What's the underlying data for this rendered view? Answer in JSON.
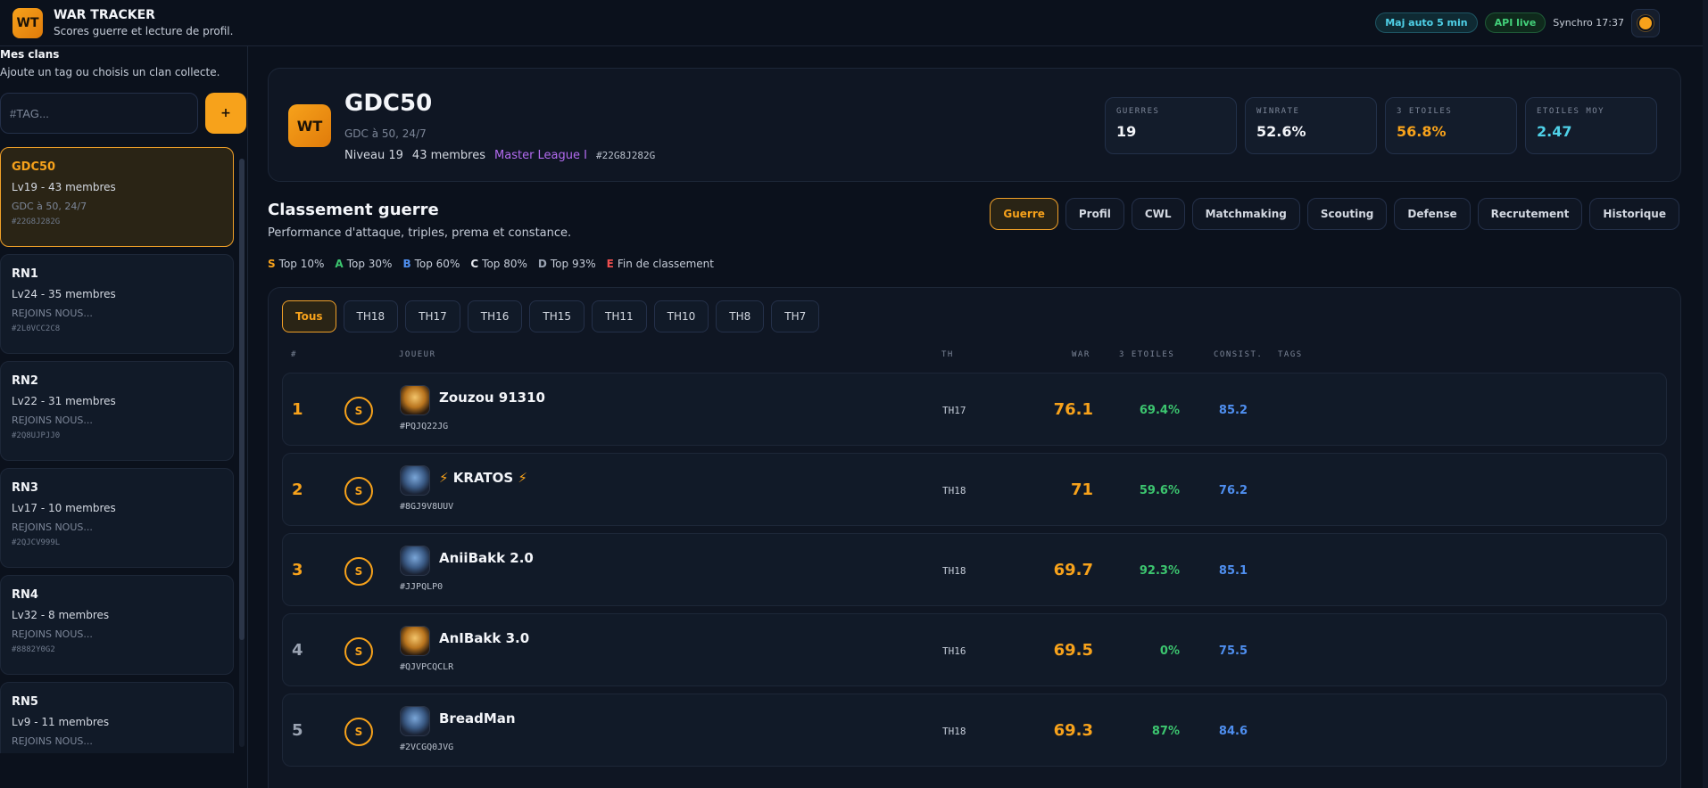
{
  "app": {
    "logo": "WT",
    "title": "WAR TRACKER",
    "subtitle": "Scores guerre et lecture de profil.",
    "pill_auto": "Maj auto 5 min",
    "pill_api": "API live",
    "sync": "Synchro 17:37",
    "theme_icon": "sun-icon"
  },
  "sidebar": {
    "title": "Mes clans",
    "subtitle": "Ajoute un tag ou choisis un clan collecte.",
    "input_placeholder": "#TAG...",
    "add_label": "+",
    "clans": [
      {
        "name": "GDC50",
        "meta": "Lv19 - 43 membres",
        "desc": "GDC à 50, 24/7",
        "tag": "#22G8J282G",
        "active": true
      },
      {
        "name": "RN1",
        "meta": "Lv24 - 35 membres",
        "desc": "REJOINS NOUS...",
        "tag": "#2L0VCC2C8",
        "active": false
      },
      {
        "name": "RN2",
        "meta": "Lv22 - 31 membres",
        "desc": "REJOINS NOUS...",
        "tag": "#2Q8UJPJJ0",
        "active": false
      },
      {
        "name": "RN3",
        "meta": "Lv17 - 10 membres",
        "desc": "REJOINS NOUS...",
        "tag": "#2QJCV999L",
        "active": false
      },
      {
        "name": "RN4",
        "meta": "Lv32 - 8 membres",
        "desc": "REJOINS NOUS...",
        "tag": "#8882Y0G2",
        "active": false
      },
      {
        "name": "RN5",
        "meta": "Lv9 - 11 membres",
        "desc": "REJOINS NOUS...",
        "tag": "",
        "active": false
      }
    ]
  },
  "clan": {
    "logo": "WT",
    "name": "GDC50",
    "desc": "GDC à 50, 24/7",
    "level": "Niveau 19",
    "members": "43 membres",
    "league": "Master League I",
    "tag": "#22G8J282G",
    "stats": [
      {
        "label": "Guerres",
        "value": "19",
        "color": "#f3f5f9"
      },
      {
        "label": "Winrate",
        "value": "52.6%",
        "color": "#f3f5f9"
      },
      {
        "label": "3 Etoiles",
        "value": "56.8%",
        "color": "#f7a21b"
      },
      {
        "label": "Etoiles moy",
        "value": "2.47",
        "color": "#4fd1e8"
      }
    ]
  },
  "section": {
    "title": "Classement guerre",
    "subtitle": "Performance d'attaque, triples, prema et constance.",
    "legend": [
      {
        "key": "S",
        "label": "Top 10%",
        "color": "#f7a21b"
      },
      {
        "key": "A",
        "label": "Top 30%",
        "color": "#3cc56f"
      },
      {
        "key": "B",
        "label": "Top 60%",
        "color": "#4f8ff0"
      },
      {
        "key": "C",
        "label": "Top 80%",
        "color": "#e6e9ef"
      },
      {
        "key": "D",
        "label": "Top 93%",
        "color": "#9aa3b2"
      },
      {
        "key": "E",
        "label": "Fin de classement",
        "color": "#ef4f4f"
      }
    ],
    "tabs": [
      "Guerre",
      "Profil",
      "CWL",
      "Matchmaking",
      "Scouting",
      "Defense",
      "Recrutement",
      "Historique"
    ],
    "active_tab": "Guerre"
  },
  "table": {
    "filters": [
      "Tous",
      "TH18",
      "TH17",
      "TH16",
      "TH15",
      "TH11",
      "TH10",
      "TH8",
      "TH7"
    ],
    "active_filter": "Tous",
    "headers": {
      "rank": "#",
      "player": "JOUEUR",
      "th": "TH",
      "war": "WAR",
      "stars": "3 ETOILES",
      "cons": "CONSIST.",
      "tags": "TAGS"
    },
    "rows": [
      {
        "rank": "1",
        "tier": "S",
        "name": "Zouzou 91310",
        "tag": "#PQJQ22JG",
        "th": "TH17",
        "war": "76.1",
        "stars": "69.4%",
        "cons": "85.2",
        "avatar": "gold",
        "bolts": false
      },
      {
        "rank": "2",
        "tier": "S",
        "name": "KRATOS",
        "tag": "#8GJ9V8UUV",
        "th": "TH18",
        "war": "71",
        "stars": "59.6%",
        "cons": "76.2",
        "avatar": "blue",
        "bolts": true
      },
      {
        "rank": "3",
        "tier": "S",
        "name": "AniiBakk 2.0",
        "tag": "#JJPQLP0",
        "th": "TH18",
        "war": "69.7",
        "stars": "92.3%",
        "cons": "85.1",
        "avatar": "blue",
        "bolts": false
      },
      {
        "rank": "4",
        "tier": "S",
        "name": "AnIBakk 3.0",
        "tag": "#QJVPCQCLR",
        "th": "TH16",
        "war": "69.5",
        "stars": "0%",
        "cons": "75.5",
        "avatar": "gold",
        "bolts": false
      },
      {
        "rank": "5",
        "tier": "S",
        "name": "BreadMan",
        "tag": "#2VCGQ0JVG",
        "th": "TH18",
        "war": "69.3",
        "stars": "87%",
        "cons": "84.6",
        "avatar": "blue",
        "bolts": false
      }
    ]
  }
}
